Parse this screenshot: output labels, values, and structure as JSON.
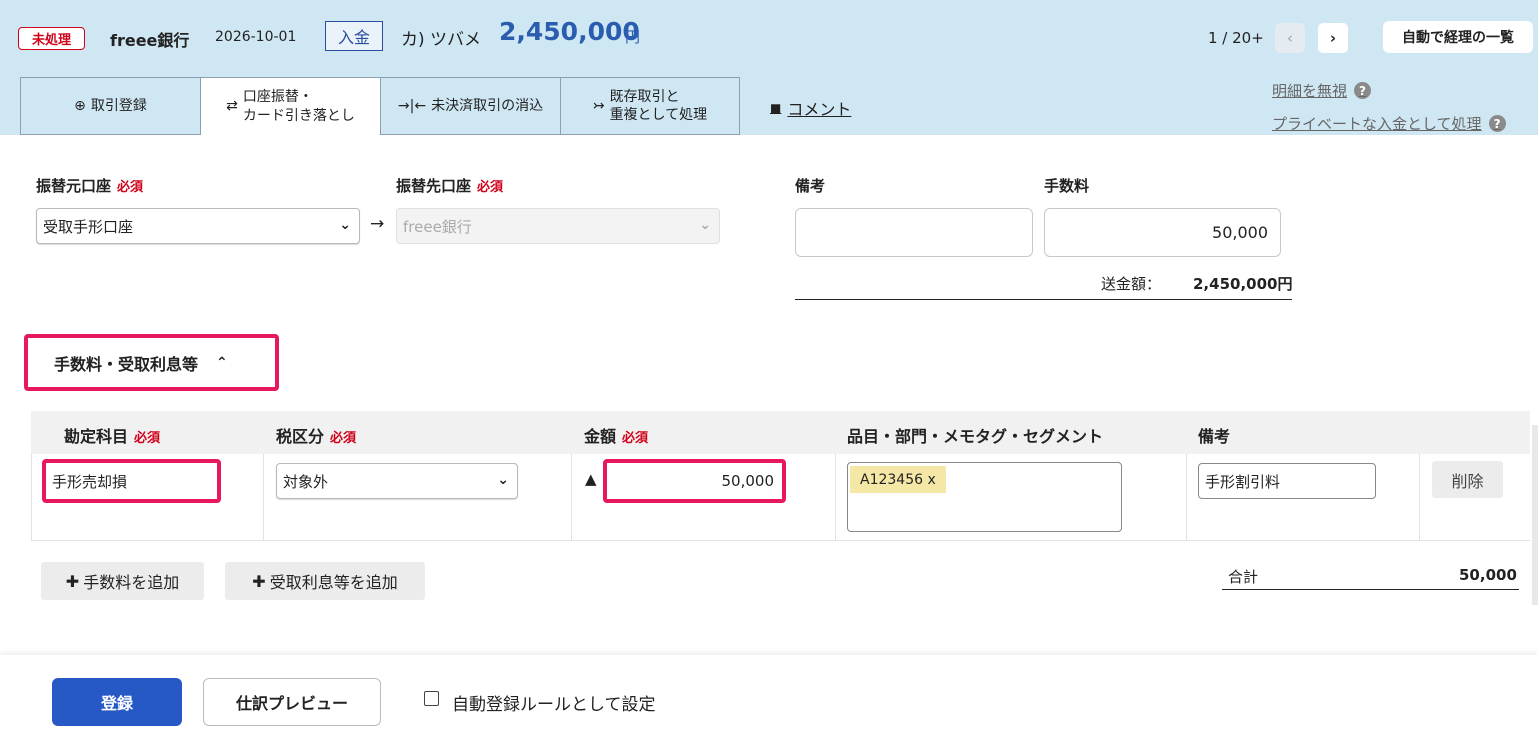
{
  "header": {
    "status": "未処理",
    "bank": "freee銀行",
    "date": "2026-10-01",
    "type": "入金",
    "partner": "カ) ツバメ",
    "amount": "2,450,000",
    "currency": "円",
    "pager": "1 / 20+",
    "list_button": "自動で経理の一覧"
  },
  "tabs": [
    {
      "label": "取引登録",
      "icon": "plus-circle-icon"
    },
    {
      "label_line1": "口座振替・",
      "label_line2": "カード引き落とし",
      "icon": "swap-icon",
      "active": true
    },
    {
      "label": "未決済取引の消込",
      "icon": "merge-icon"
    },
    {
      "label_line1": "既存取引と",
      "label_line2": "重複として処理",
      "icon": "duplicate-icon"
    }
  ],
  "comment_link": "コメント",
  "side_links": {
    "ignore": "明細を無視",
    "private": "プライベートな入金として処理",
    "help": "?"
  },
  "form": {
    "required": "必須",
    "from_label": "振替元口座",
    "from_value": "受取手形口座",
    "to_label": "振替先口座",
    "to_value": "freee銀行",
    "note_label": "備考",
    "note_value": "",
    "fee_label": "手数料",
    "fee_value": "50,000",
    "transfer_label": "送金額：",
    "transfer_value": "2,450,000円"
  },
  "section_title": "手数料・受取利息等",
  "table": {
    "headers": [
      "勘定科目",
      "税区分",
      "金額",
      "品目・部門・メモタグ・セグメント",
      "備考"
    ],
    "row": {
      "account": "手形売却損",
      "tax": "対象外",
      "sign": "▲",
      "amount": "50,000",
      "tag": "A123456",
      "tag_remove": "x",
      "note": "手形割引料",
      "delete": "削除"
    }
  },
  "add_buttons": {
    "fee": "手数料を追加",
    "interest": "受取利息等を追加"
  },
  "total": {
    "label": "合計",
    "value": "50,000"
  },
  "footer": {
    "submit": "登録",
    "preview": "仕訳プレビュー",
    "auto_rule": "自動登録ルールとして設定"
  },
  "colors": {
    "header_bg": "#cfe7f3",
    "accent_blue": "#2659c6",
    "amount_blue": "#2a5db0",
    "highlight": "#e8185e",
    "required_red": "#d0021b"
  }
}
